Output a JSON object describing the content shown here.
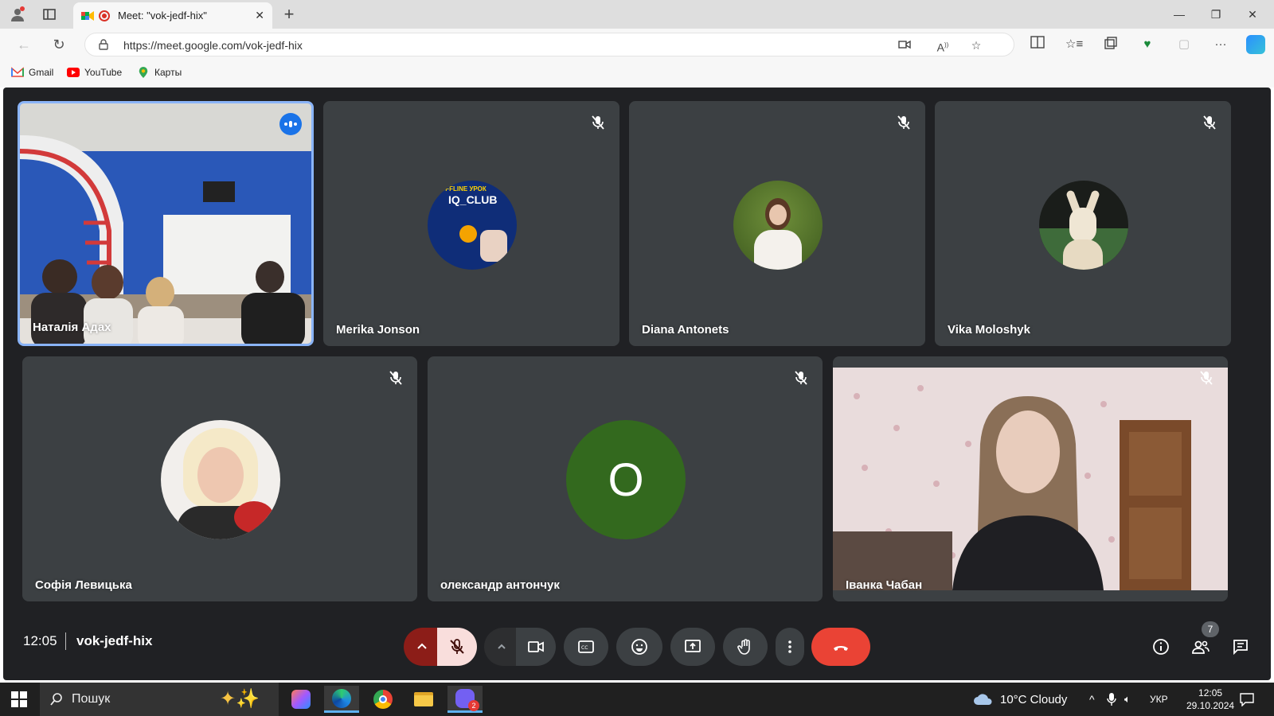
{
  "browser": {
    "tab_title": "Meet: \"vok-jedf-hix\"",
    "url": "https://meet.google.com/vok-jedf-hix",
    "bookmarks": [
      {
        "label": "Gmail"
      },
      {
        "label": "YouTube"
      },
      {
        "label": "Карты"
      }
    ]
  },
  "participants": [
    {
      "name": "Наталія Адах",
      "speaking": true
    },
    {
      "name": "Merika Jonson",
      "muted": true
    },
    {
      "name": "Diana Antonets",
      "muted": true
    },
    {
      "name": "Vika Moloshyk",
      "muted": true
    },
    {
      "name": "Софія Левицька",
      "muted": true
    },
    {
      "name": "олександр антончук",
      "muted": true,
      "initial": "О"
    },
    {
      "name": "Іванка Чабан",
      "muted": true
    }
  ],
  "avatar_text": {
    "iq_club": "IQ_CLUB",
    "iq_offline": "OFFLINE УРОК"
  },
  "meeting": {
    "time": "12:05",
    "code": "vok-jedf-hix",
    "participant_count": "7"
  },
  "taskbar": {
    "search_placeholder": "Пошук",
    "weather": "10°C  Cloudy",
    "language": "УКР",
    "clock_time": "12:05",
    "clock_date": "29.10.2024",
    "badge": "2"
  },
  "colors": {
    "meet_bg": "#202124",
    "tile_bg": "#3c4043",
    "end_call": "#ea4335",
    "mic_off": "#f9dedc",
    "speaking_ring": "#8ab4f8",
    "avatar_green": "#33691e"
  }
}
